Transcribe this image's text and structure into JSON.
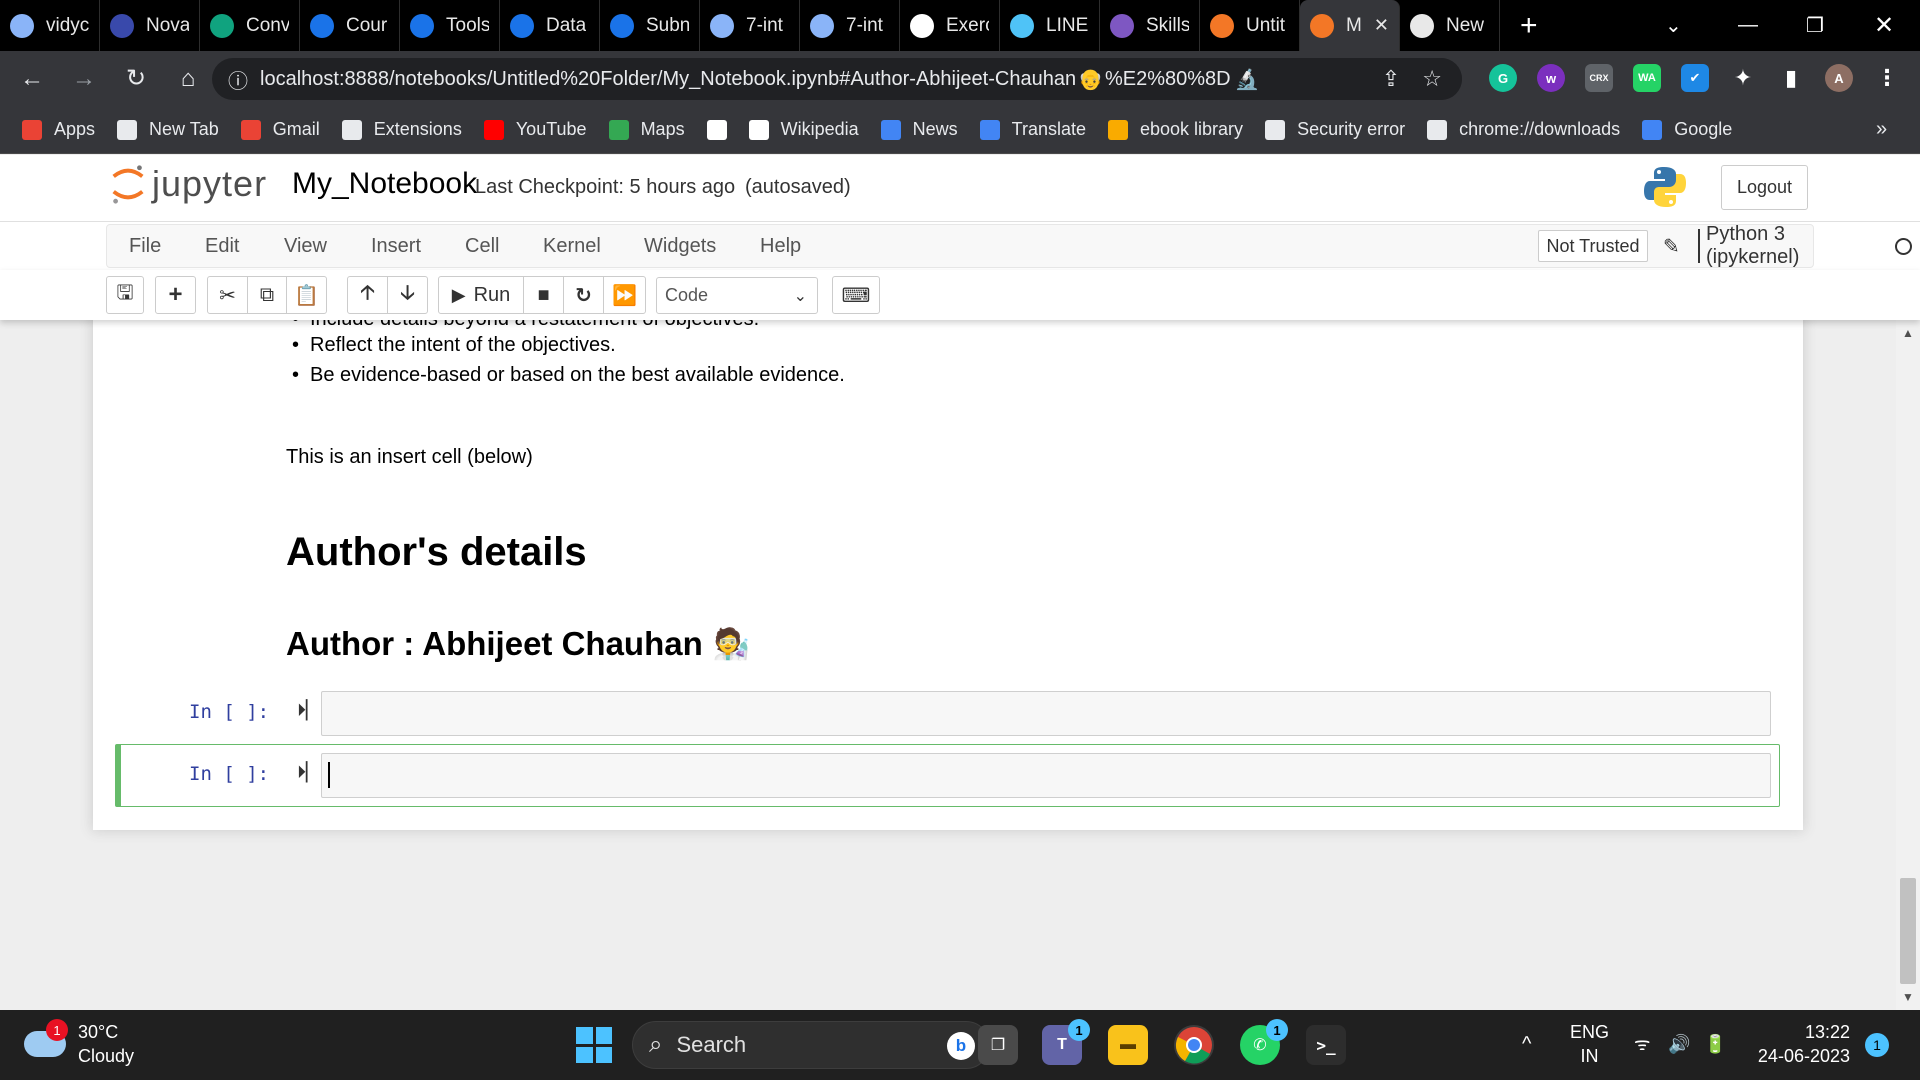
{
  "browser": {
    "tabs": [
      {
        "title": "vidyc",
        "icon": "chrome-globe-icon",
        "color": "#8ab4f8"
      },
      {
        "title": "Nova",
        "icon": "play-icon",
        "color": "#3949ab"
      },
      {
        "title": "Conv",
        "icon": "chatgpt-icon",
        "color": "#10a37f"
      },
      {
        "title": "Cour",
        "icon": "c-logo-icon",
        "color": "#1a73e8"
      },
      {
        "title": "Tools",
        "icon": "c-logo-icon",
        "color": "#1a73e8"
      },
      {
        "title": "Data",
        "icon": "c-logo-icon",
        "color": "#1a73e8"
      },
      {
        "title": "Subn",
        "icon": "c-logo-icon",
        "color": "#1a73e8"
      },
      {
        "title": "7-int",
        "icon": "chrome-globe-icon",
        "color": "#8ab4f8"
      },
      {
        "title": "7-int",
        "icon": "chrome-globe-icon",
        "color": "#8ab4f8"
      },
      {
        "title": "Exerc",
        "icon": "github-icon",
        "color": "#ffffff"
      },
      {
        "title": "LINE",
        "icon": "circle-o-icon",
        "color": "#4fc3f7"
      },
      {
        "title": "Skills",
        "icon": "skills-icon",
        "color": "#7e57c2"
      },
      {
        "title": "Untit",
        "icon": "jupyter-icon",
        "color": "#f37726"
      },
      {
        "title": "M",
        "icon": "notebook-icon",
        "color": "#f37726"
      },
      {
        "title": "New",
        "icon": "chrome-globe-icon",
        "color": "#e8e8e8"
      }
    ],
    "active_tab_index": 13,
    "url_host": "localhost",
    "url_rest": ":8888/notebooks/Untitled%20Folder/My_Notebook.ipynb#Author-Abhijeet-Chauhan",
    "url_tail": "%E2%80%8D",
    "bookmarks": [
      {
        "label": "Apps",
        "icon": "apps-grid-icon",
        "color": "#ea4335"
      },
      {
        "label": "New Tab",
        "icon": "chrome-globe-icon",
        "color": "#e8eaed"
      },
      {
        "label": "Gmail",
        "icon": "gmail-icon",
        "color": "#ea4335"
      },
      {
        "label": "Extensions",
        "icon": "puzzle-icon",
        "color": "#e8eaed"
      },
      {
        "label": "YouTube",
        "icon": "youtube-icon",
        "color": "#ff0000"
      },
      {
        "label": "Maps",
        "icon": "maps-pin-icon",
        "color": "#34a853"
      },
      {
        "label": "",
        "icon": "wikipedia-icon",
        "color": "#ffffff"
      },
      {
        "label": "Wikipedia",
        "icon": "wikipedia-icon",
        "color": "#ffffff"
      },
      {
        "label": "News",
        "icon": "google-news-icon",
        "color": "#4285f4"
      },
      {
        "label": "Translate",
        "icon": "google-translate-icon",
        "color": "#4285f4"
      },
      {
        "label": "ebook library",
        "icon": "ebook-icon",
        "color": "#f9ab00"
      },
      {
        "label": "Security error",
        "icon": "chrome-globe-icon",
        "color": "#e8eaed"
      },
      {
        "label": "chrome://downloads",
        "icon": "download-icon",
        "color": "#e8eaed"
      },
      {
        "label": "Google",
        "icon": "google-icon",
        "color": "#4285f4"
      }
    ],
    "bookmarks_overflow": "»"
  },
  "jupyter": {
    "logo_text": "jupyter",
    "notebook_name": "My_Notebook",
    "checkpoint": "Last Checkpoint: 5 hours ago",
    "autosave": "(autosaved)",
    "logout_label": "Logout",
    "menu": [
      "File",
      "Edit",
      "View",
      "Insert",
      "Cell",
      "Kernel",
      "Widgets",
      "Help"
    ],
    "trust_label": "Not Trusted",
    "kernel_name": "Python 3 (ipykernel)",
    "toolbar": {
      "run_label": "Run",
      "cell_type": "Code"
    }
  },
  "notebook": {
    "cut_off_line": "Include details beyond a restatement of objectives.",
    "bullets": [
      "Reflect the intent of the objectives.",
      "Be evidence-based or based on the best available evidence."
    ],
    "insert_note": "This is an insert cell (below)",
    "heading1": "Author's details",
    "heading2": "Author : Abhijeet Chauhan",
    "cells": [
      {
        "prompt": "In [ ]:",
        "content": "",
        "selected": false
      },
      {
        "prompt": "In [ ]:",
        "content": "",
        "selected": true
      }
    ]
  },
  "taskbar": {
    "weather_temp": "30°C",
    "weather_desc": "Cloudy",
    "weather_badge": "1",
    "search_label": "Search",
    "lang_1": "ENG",
    "lang_2": "IN",
    "time": "13:22",
    "date": "24-06-2023",
    "notification_count": "1",
    "teams_badge": "1",
    "whatsapp_badge": "1"
  }
}
